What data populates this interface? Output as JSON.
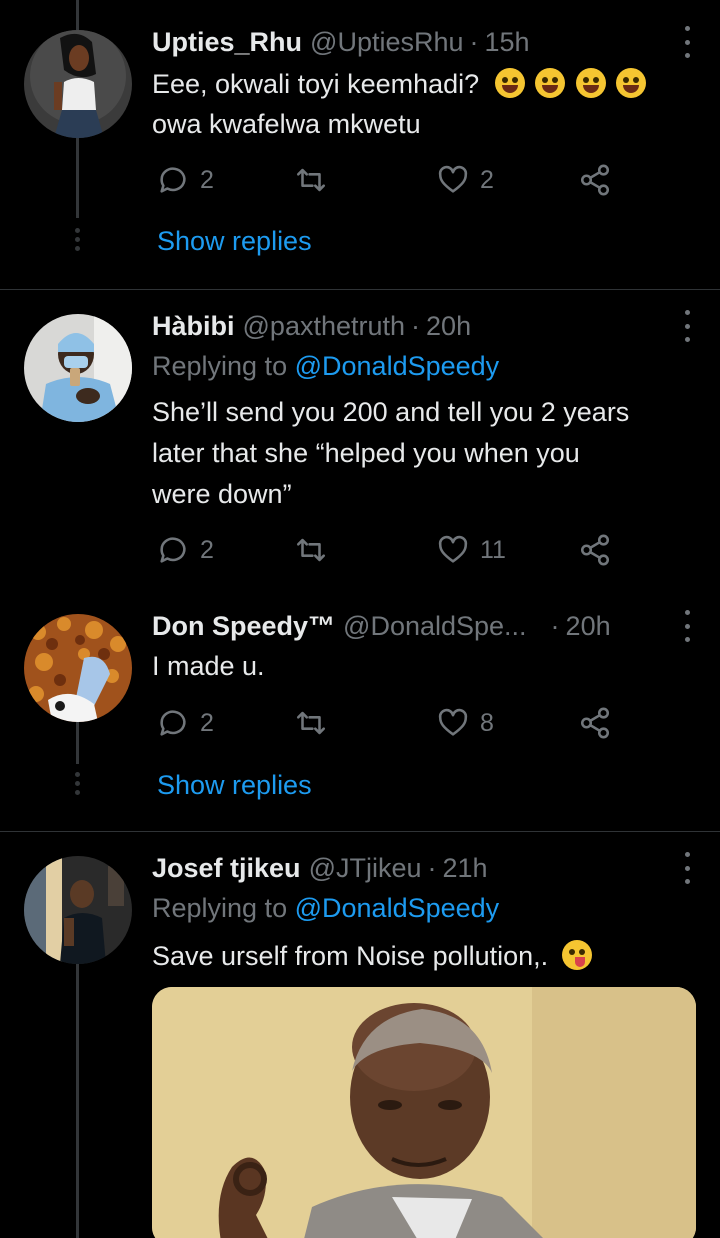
{
  "tweets": [
    {
      "name": "Upties_Rhu",
      "handle": "@UptiesRhu",
      "time": "15h",
      "text_lines": [
        "Eee, okwali toyi keemhadi?",
        "owa kwafelwa mkwetu"
      ],
      "emoji": [
        "rolling-on-floor-laughing",
        "rolling-on-floor-laughing",
        "rolling-on-floor-laughing",
        "rolling-on-floor-laughing"
      ],
      "replies": "2",
      "likes": "2",
      "show_replies": "Show replies"
    },
    {
      "name": "Hàbibi",
      "handle": "@paxthetruth",
      "time": "20h",
      "replying_label": "Replying to",
      "replying_to": "@DonaldSpeedy",
      "text_lines": [
        "She’ll send you 200 and tell you 2 years",
        "later that she “helped you when you",
        "were down”"
      ],
      "replies": "2",
      "likes": "11"
    },
    {
      "name": "Don Speedy™",
      "handle": "@DonaldSpe...",
      "time": "20h",
      "text_lines": [
        "I made u."
      ],
      "replies": "2",
      "likes": "8",
      "show_replies": "Show replies"
    },
    {
      "name": "Josef tjikeu",
      "handle": "@JTjikeu",
      "time": "21h",
      "replying_label": "Replying to",
      "replying_to": "@DonaldSpeedy",
      "text_lines": [
        "Save urself from Noise pollution,."
      ],
      "emoji": [
        "winking-face-with-tongue"
      ]
    }
  ],
  "separator": "·",
  "colors": {
    "background": "#000000",
    "text": "#e7e9ea",
    "muted": "#71767b",
    "accent": "#1d9bf0"
  }
}
